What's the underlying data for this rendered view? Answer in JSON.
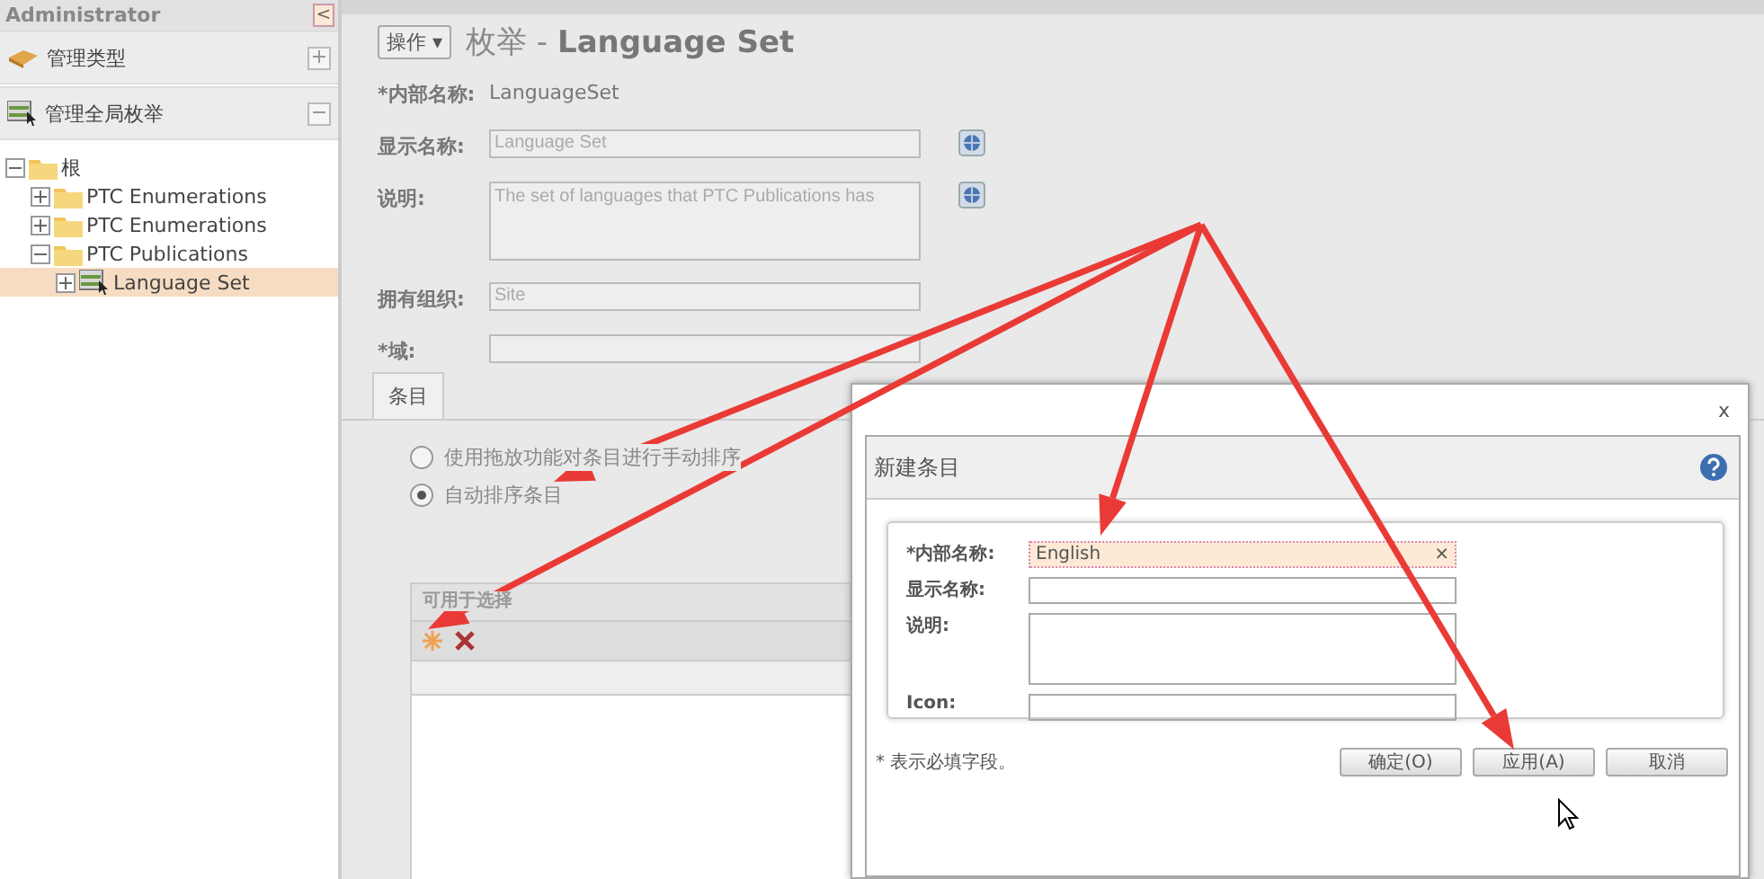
{
  "sidebar": {
    "title": "Administrator",
    "collapse": "<",
    "sections": [
      {
        "label": "管理类型",
        "kind": "type",
        "expanded": false
      },
      {
        "label": "管理全局枚举",
        "kind": "enum",
        "expanded": true
      }
    ],
    "tree": [
      {
        "label": "根",
        "kind": "folder",
        "expanded": true,
        "selected": false,
        "children": [
          {
            "label": "PTC Enumerations",
            "kind": "folder",
            "expanded": false,
            "selected": false
          },
          {
            "label": "PTC Enumerations",
            "kind": "folder",
            "expanded": false,
            "selected": false
          },
          {
            "label": "PTC Publications",
            "kind": "folder",
            "expanded": true,
            "selected": false,
            "children": [
              {
                "label": "Language Set",
                "kind": "enum",
                "expanded": false,
                "selected": true
              }
            ]
          }
        ]
      }
    ]
  },
  "header": {
    "actions_button": "操作 ▾",
    "title_prefix": "枚举 -",
    "title_name": "Language Set"
  },
  "fields": [
    {
      "label": "*内部名称:",
      "kind": "text",
      "value": "LanguageSet",
      "globe": false
    },
    {
      "label": "显示名称:",
      "kind": "input",
      "value": "Language Set",
      "globe": true
    },
    {
      "label": "说明:",
      "kind": "textarea",
      "value": "The set of languages that PTC Publications has",
      "globe": true
    },
    {
      "label": "拥有组织:",
      "kind": "input",
      "value": "Site",
      "globe": false
    },
    {
      "label": "*域:",
      "kind": "input",
      "globe": false
    }
  ],
  "tabs": [
    {
      "label": "条目",
      "selected": true
    }
  ],
  "radios": [
    {
      "label": "使用拖放功能对条目进行手动排序",
      "selected": false
    },
    {
      "label": "自动排序条目",
      "selected": true
    }
  ],
  "table": {
    "title": "可用于选择"
  },
  "dialog": {
    "close": "x",
    "title": "新建条目",
    "fields": [
      {
        "label": "*内部名称:",
        "kind": "input",
        "value": "English",
        "focused": true,
        "clear": "×"
      },
      {
        "label": "显示名称:",
        "kind": "input",
        "focused": false
      },
      {
        "label": "说明:",
        "kind": "textarea",
        "focused": false
      },
      {
        "label": "Icon:",
        "kind": "input",
        "focused": false
      }
    ],
    "note": "* 表示必填字段。",
    "buttons": [
      "确定(O)",
      "应用(A)",
      "取消"
    ]
  }
}
